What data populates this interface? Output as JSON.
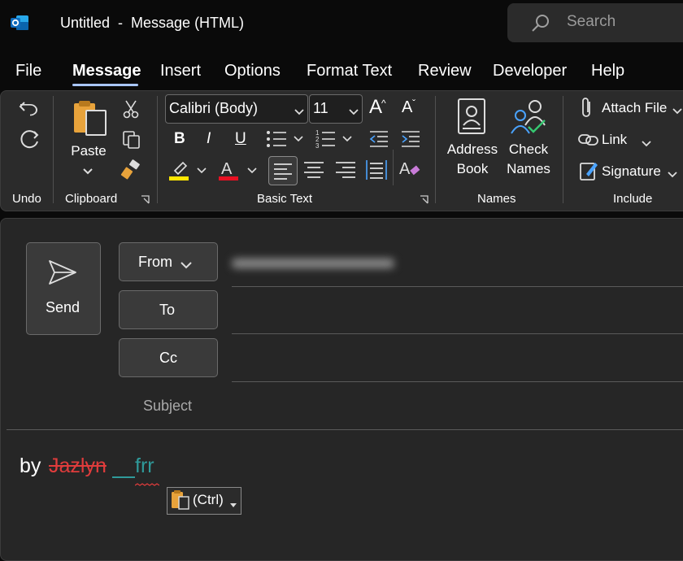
{
  "window": {
    "title": "Untitled  -  Message (HTML)",
    "app_icon": "outlook-icon",
    "search_placeholder": "Search"
  },
  "tabs": [
    {
      "label": "File",
      "active": false
    },
    {
      "label": "Message",
      "active": true
    },
    {
      "label": "Insert",
      "active": false
    },
    {
      "label": "Options",
      "active": false
    },
    {
      "label": "Format Text",
      "active": false
    },
    {
      "label": "Review",
      "active": false
    },
    {
      "label": "Developer",
      "active": false
    },
    {
      "label": "Help",
      "active": false
    }
  ],
  "ribbon": {
    "groups": {
      "undo": "Undo",
      "clipboard": "Clipboard",
      "basic_text": "Basic Text",
      "names": "Names",
      "include": "Include"
    },
    "paste_label": "Paste",
    "font_name": "Calibri (Body)",
    "font_size": "11",
    "grow_font": "A",
    "shrink_font": "A",
    "bold": "B",
    "italic": "I",
    "underline": "U",
    "highlight_color": "#ffe600",
    "font_color": "#e81123",
    "address_book": [
      "Address",
      "Book"
    ],
    "check_names": [
      "Check",
      "Names"
    ],
    "attach_file": "Attach File",
    "link": "Link",
    "signature": "Signature"
  },
  "compose": {
    "send_label": "Send",
    "from_label": "From",
    "to_label": "To",
    "cc_label": "Cc",
    "subject_label": "Subject",
    "body": {
      "prefix": "by ",
      "struck": "Jazlyn",
      "inserted": "frr"
    },
    "paste_options": "(Ctrl)"
  },
  "colors": {
    "accent_underline": "#a9c6ff",
    "strike_text": "#e03c3c",
    "inserted_text": "#2f9a9a"
  }
}
